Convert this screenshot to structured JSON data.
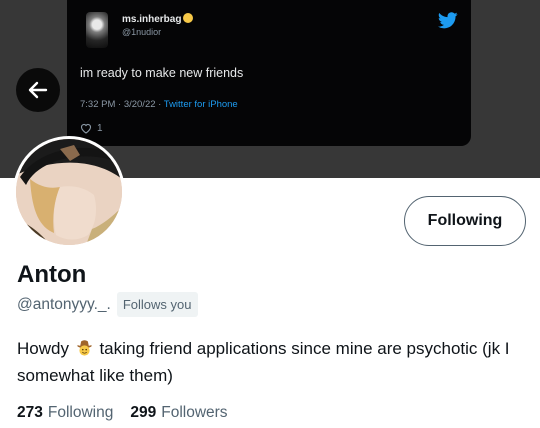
{
  "tweet": {
    "display_name": "ms.inherbag",
    "handle": "@1nudior",
    "text": "im ready to make new friends",
    "timestamp": "7:32 PM · 3/20/22 · ",
    "source": "Twitter for iPhone",
    "likes": "1",
    "brand_color": "#1d9bf0"
  },
  "profile": {
    "name": "Anton",
    "handle": "@antonyyy._.",
    "follows_you_badge": "Follows you",
    "follow_button_label": "Following",
    "bio_part1": "Howdy",
    "bio_emoji": "cowboy-face-emoji",
    "bio_part2": "taking friend applications since mine are psychotic (jk I somewhat like them)",
    "following_count": "273",
    "following_label": "Following",
    "followers_count": "299",
    "followers_label": "Followers"
  },
  "icons": {
    "back": "arrow-left-icon",
    "twitter": "twitter-bird-icon",
    "like": "heart-icon"
  },
  "colors": {
    "header_bg": "#373737",
    "tweet_card_bg": "#050506",
    "text_primary": "#0f1419",
    "text_secondary": "#536471",
    "badge_bg": "#eff3f4"
  }
}
